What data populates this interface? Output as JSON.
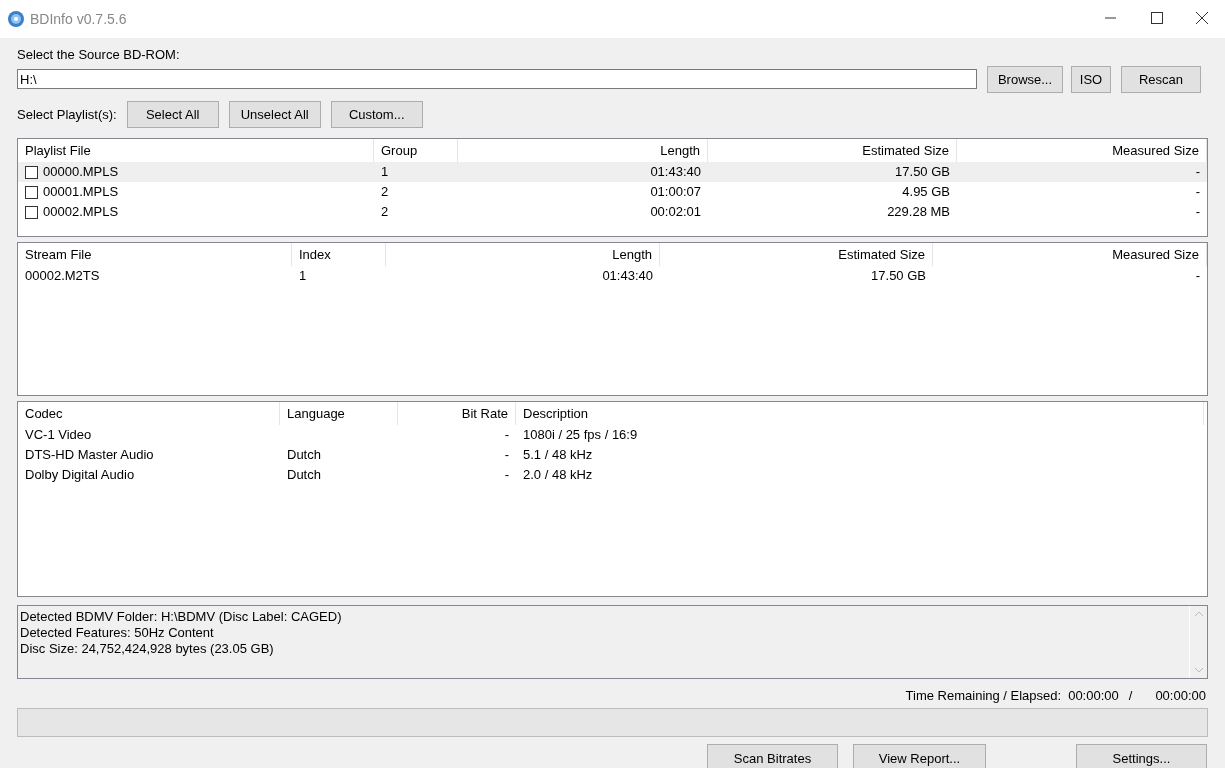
{
  "window": {
    "title": "BDInfo v0.7.5.6"
  },
  "source": {
    "label": "Select the Source BD-ROM:",
    "value": "H:\\",
    "buttons": [
      "Browse...",
      "ISO",
      "Rescan"
    ]
  },
  "playlist_select": {
    "label": "Select Playlist(s):",
    "buttons": [
      "Select All",
      "Unselect All",
      "Custom..."
    ]
  },
  "playlists": {
    "columns": [
      "Playlist File",
      "Group",
      "Length",
      "Estimated Size",
      "Measured Size"
    ],
    "rows": [
      {
        "cells": [
          "00000.MPLS",
          "1",
          "01:43:40",
          "17.50 GB",
          "-"
        ],
        "checked": false,
        "selected": true
      },
      {
        "cells": [
          "00001.MPLS",
          "2",
          "01:00:07",
          "4.95 GB",
          "-"
        ],
        "checked": false,
        "selected": false
      },
      {
        "cells": [
          "00002.MPLS",
          "2",
          "00:02:01",
          "229.28 MB",
          "-"
        ],
        "checked": false,
        "selected": false
      }
    ]
  },
  "streams": {
    "columns": [
      "Stream File",
      "Index",
      "Length",
      "Estimated Size",
      "Measured Size"
    ],
    "rows": [
      {
        "cells": [
          "00002.M2TS",
          "1",
          "01:43:40",
          "17.50 GB",
          "-"
        ]
      }
    ]
  },
  "codecs": {
    "columns": [
      "Codec",
      "Language",
      "Bit Rate",
      "Description"
    ],
    "rows": [
      {
        "cells": [
          "VC-1 Video",
          "",
          "-",
          "1080i / 25 fps / 16:9"
        ]
      },
      {
        "cells": [
          "DTS-HD Master Audio",
          "Dutch",
          "-",
          "5.1 / 48 kHz"
        ]
      },
      {
        "cells": [
          "Dolby Digital Audio",
          "Dutch",
          "-",
          "2.0 / 48 kHz"
        ]
      }
    ]
  },
  "info_lines": [
    "Detected BDMV Folder: H:\\BDMV (Disc Label: CAGED)",
    "Detected Features: 50Hz Content",
    "Disc Size: 24,752,424,928 bytes (23.05 GB)"
  ],
  "time": {
    "label": "Time Remaining / Elapsed:",
    "remaining": "00:00:00",
    "separator": "/",
    "elapsed": "00:00:00"
  },
  "progress": {
    "level": 0
  },
  "bottom_buttons": [
    "Scan Bitrates",
    "View Report...",
    "Settings..."
  ]
}
